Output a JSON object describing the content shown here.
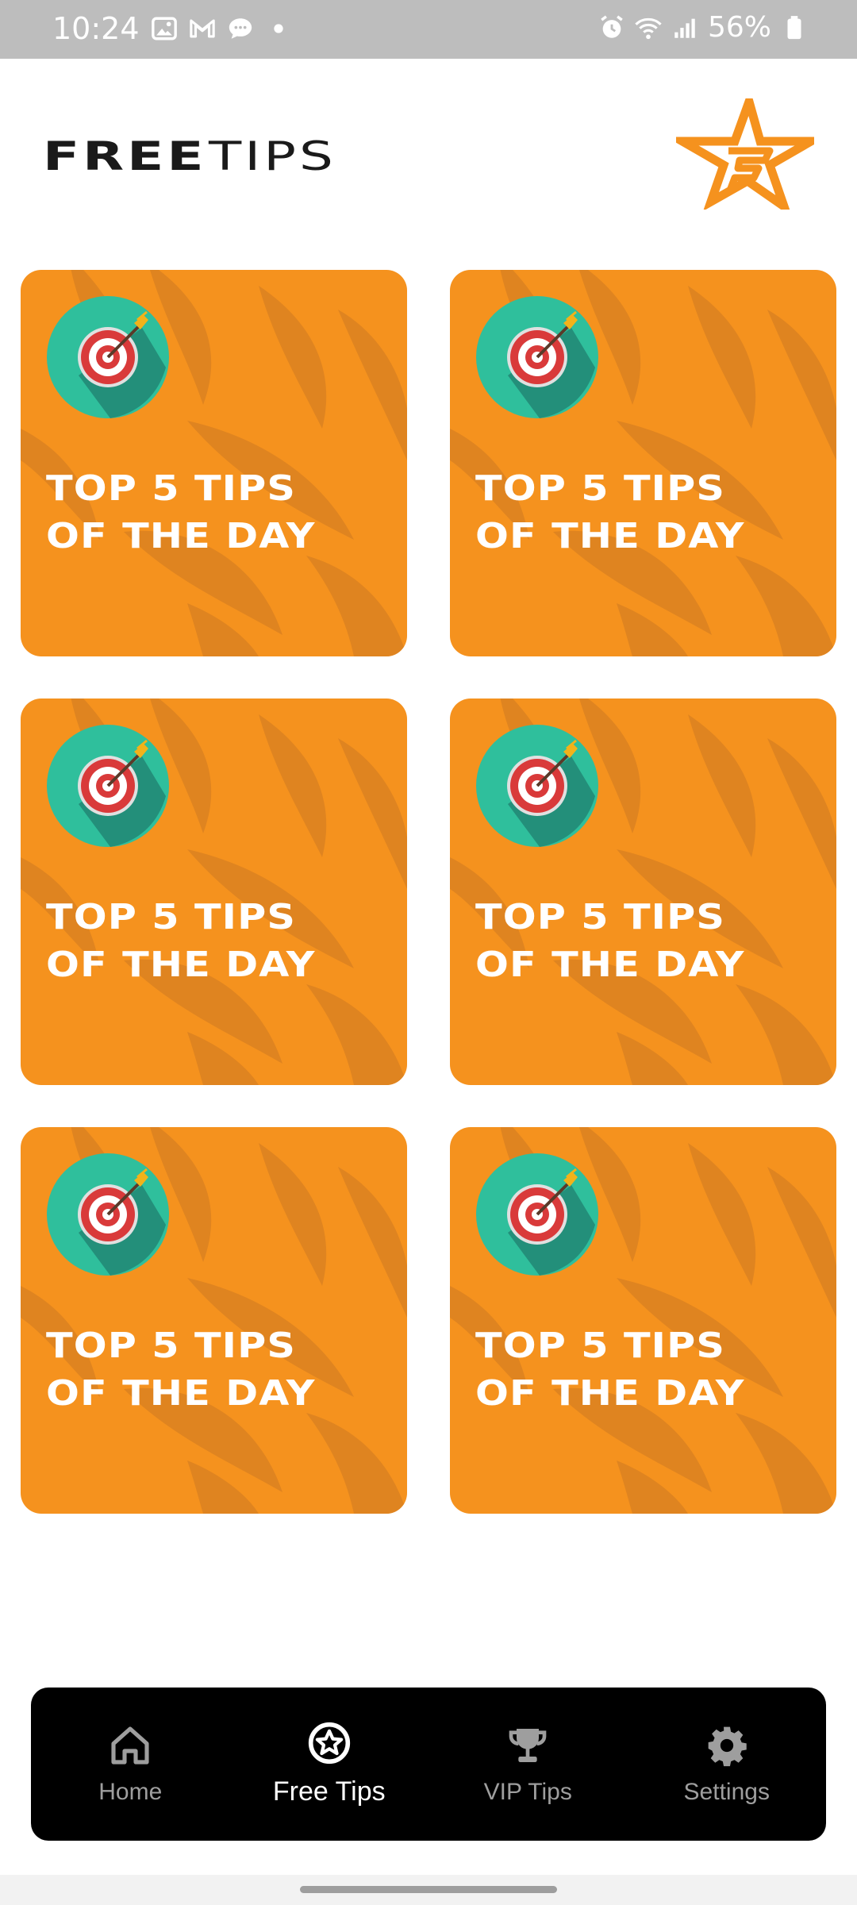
{
  "status_bar": {
    "time": "10:24",
    "battery": "56%",
    "left_icons": [
      "gallery-icon",
      "gmail-icon",
      "chat-icon",
      "dot-icon"
    ],
    "right_icons": [
      "alarm-icon",
      "wifi-icon",
      "signal-icon",
      "battery-icon"
    ]
  },
  "header": {
    "title_bold": "FREE",
    "title_light": "TIPS",
    "logo_icon": "star-logo-icon"
  },
  "cards": [
    {
      "line1": "TOP 5 TIPS",
      "line2": "OF THE DAY",
      "icon": "target-icon"
    },
    {
      "line1": "TOP 5 TIPS",
      "line2": "OF THE DAY",
      "icon": "target-icon"
    },
    {
      "line1": "TOP 5 TIPS",
      "line2": "OF THE DAY",
      "icon": "target-icon"
    },
    {
      "line1": "TOP 5 TIPS",
      "line2": "OF THE DAY",
      "icon": "target-icon"
    },
    {
      "line1": "TOP 5 TIPS",
      "line2": "OF THE DAY",
      "icon": "target-icon"
    },
    {
      "line1": "TOP 5 TIPS",
      "line2": "OF THE DAY",
      "icon": "target-icon"
    }
  ],
  "nav": {
    "items": [
      {
        "label": "Home",
        "icon": "home-icon"
      },
      {
        "label": "Free Tips",
        "icon": "star-circle-icon",
        "active": true
      },
      {
        "label": "VIP Tips",
        "icon": "trophy-icon"
      },
      {
        "label": "Settings",
        "icon": "gear-icon"
      }
    ]
  },
  "colors": {
    "accent": "#f5921e",
    "card_pattern": "#df8420",
    "target_circle": "#2fbf9c",
    "nav_bg": "#000000"
  }
}
